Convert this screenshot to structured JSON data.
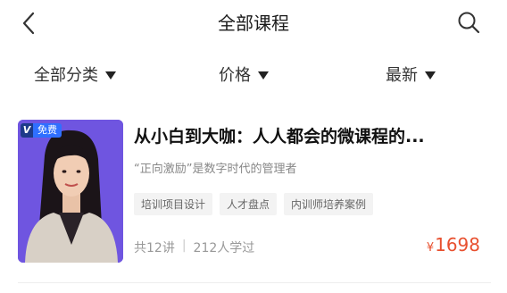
{
  "header": {
    "title": "全部课程",
    "back_icon": "back-arrow-icon",
    "search_icon": "search-icon"
  },
  "filters": [
    {
      "label": "全部分类"
    },
    {
      "label": "价格"
    },
    {
      "label": "最新"
    }
  ],
  "course": {
    "badge_v": "V",
    "badge_text": "免费",
    "title": "从小白到大咖：人人都会的微课程的...",
    "subtitle": "“正向激励”是数字时代的管理者",
    "tags": [
      "培训项目设计",
      "人才盘点",
      "内训师培养案例"
    ],
    "lessons": "共12讲",
    "separator": "|",
    "learners": "212人学过",
    "currency": "¥",
    "price": "1698"
  },
  "colors": {
    "price": "#e8502f",
    "thumbnail_bg": "#6f55e0",
    "badge_blue": "#2f6fff"
  }
}
